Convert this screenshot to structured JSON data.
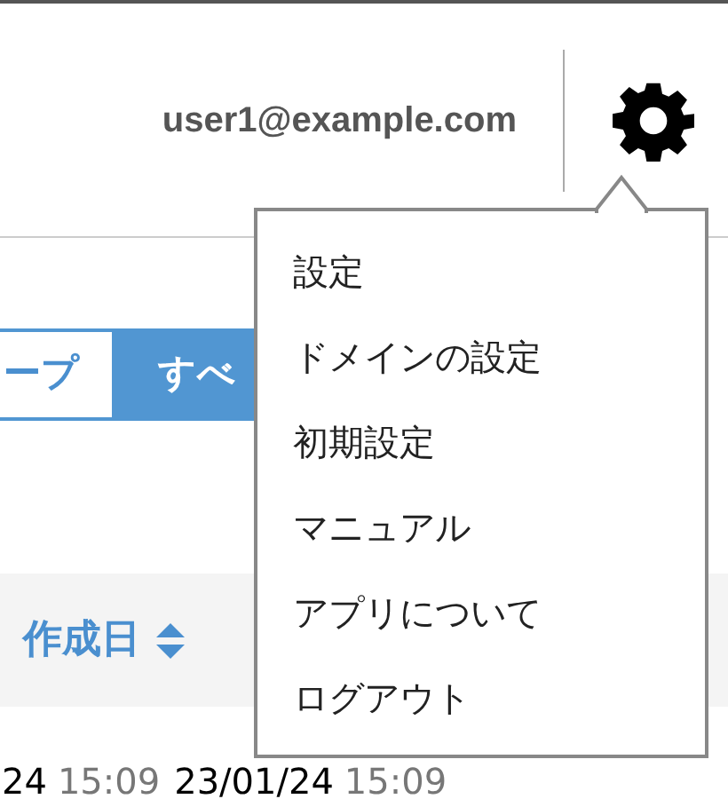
{
  "header": {
    "user_email": "user1@example.com"
  },
  "filter_tabs": [
    {
      "label": "ープ",
      "selected": false
    },
    {
      "label": "すべ",
      "selected": true
    }
  ],
  "table": {
    "columns": [
      {
        "label": "作成日",
        "sortable": true
      }
    ],
    "rows": [
      {
        "cells": [
          {
            "date": "24",
            "time": "15:09"
          },
          {
            "date": "23/01/24",
            "time": "15:09"
          }
        ]
      }
    ]
  },
  "settings_menu": {
    "items": [
      {
        "label": "設定"
      },
      {
        "label": "ドメインの設定"
      },
      {
        "label": "初期設定"
      },
      {
        "label": "マニュアル"
      },
      {
        "label": "アプリについて"
      },
      {
        "label": "ログアウト"
      }
    ]
  }
}
